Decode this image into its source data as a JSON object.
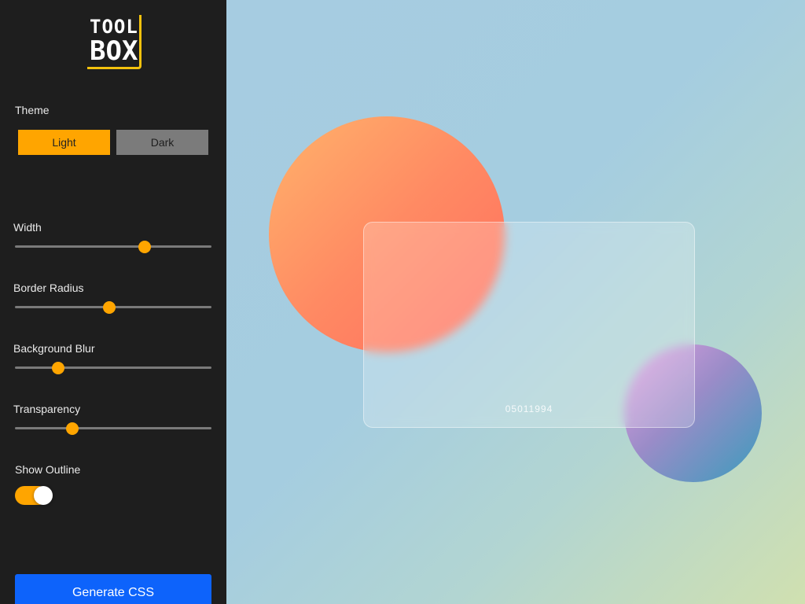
{
  "logo": {
    "line1": "TOOL",
    "line2": "BOX"
  },
  "sidebar": {
    "theme_label": "Theme",
    "theme_options": {
      "light": "Light",
      "dark": "Dark",
      "selected": "Light"
    },
    "sliders": [
      {
        "label": "Width",
        "value_percent": 66
      },
      {
        "label": "Border Radius",
        "value_percent": 48
      },
      {
        "label": "Background Blur",
        "value_percent": 22
      },
      {
        "label": "Transparency",
        "value_percent": 29
      }
    ],
    "show_outline": {
      "label": "Show Outline",
      "enabled": true
    },
    "generate_button": "Generate CSS"
  },
  "preview": {
    "card_text": "05011994"
  },
  "colors": {
    "accent": "#ffa500",
    "sidebar_bg": "#1e1e1e",
    "button_blue": "#0d63fb",
    "logo_border": "#f4c20d"
  }
}
